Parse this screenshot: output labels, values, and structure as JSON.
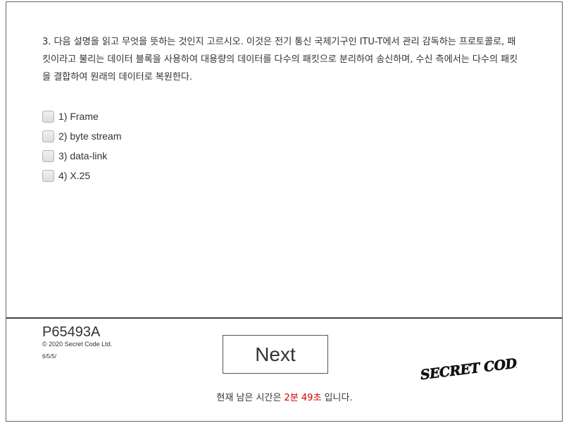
{
  "question": {
    "text": "3. 다음 설명을 읽고 무엇을 뜻하는 것인지 고르시오. 이것은 전기 통신 국제기구인 ITU-T에서 관리 감독하는 프로토콜로, 패킷이라고 불리는 데이터 블록을 사용하여 대용량의 데이터를 다수의 패킷으로 분리하여 송신하며, 수신 측에서는 다수의 패킷을 결합하여 원래의 데이터로 복원한다."
  },
  "options": [
    {
      "label": "1) Frame",
      "checked": false
    },
    {
      "label": "2) byte stream",
      "checked": false
    },
    {
      "label": "3) data-link",
      "checked": false
    },
    {
      "label": "4) X.25",
      "checked": false
    }
  ],
  "footer": {
    "code": "P65493A",
    "copyright": "© 2020 Secret Code Ltd.",
    "version": "6/5/5/",
    "next_label": "Next",
    "logo_text": "SECRET CODE"
  },
  "timer": {
    "prefix": "현재 남은 시간은 ",
    "remaining": "2분 49초",
    "suffix": " 입니다.",
    "color": "#d40000"
  }
}
